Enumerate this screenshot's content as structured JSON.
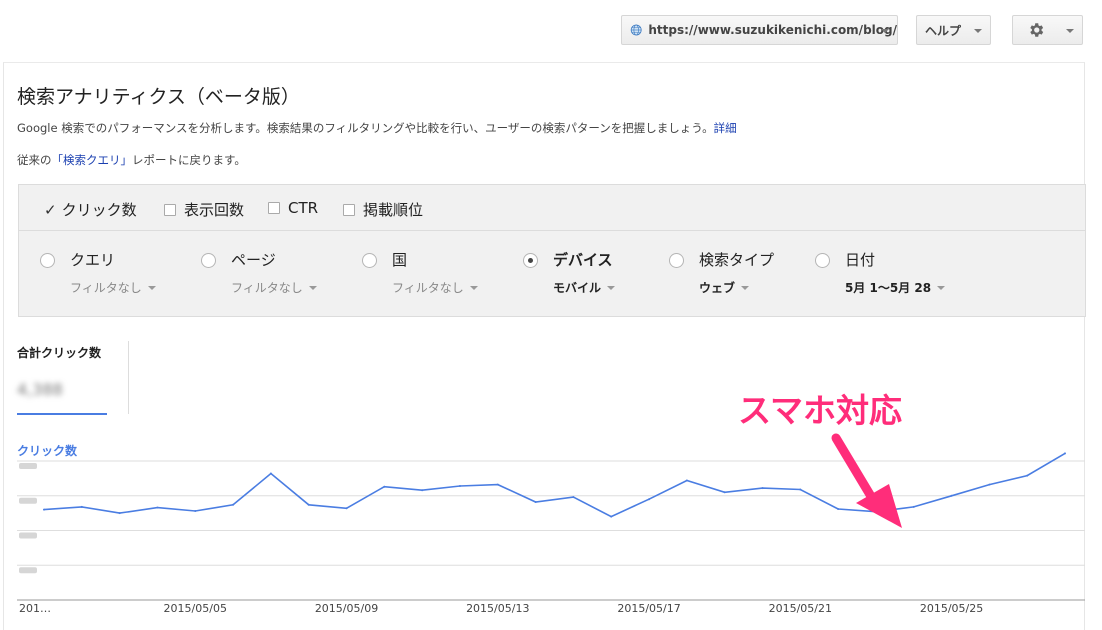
{
  "topbar": {
    "site_url": "https://www.suzukikenichi.com/blog/",
    "help_label": "ヘルプ",
    "site_icon": "globe-icon",
    "settings_icon": "gear-icon"
  },
  "page": {
    "title": "検索アナリティクス（ベータ版）",
    "description": "Google 検索でのパフォーマンスを分析します。検索結果のフィルタリングや比較を行い、ユーザーの検索パターンを把握しましょう。",
    "description_link": "詳細",
    "legacy_prefix": "従来の",
    "legacy_link": "「検索クエリ」",
    "legacy_suffix": "レポートに戻ります。"
  },
  "metrics": [
    {
      "label": "クリック数",
      "checked": true
    },
    {
      "label": "表示回数",
      "checked": false
    },
    {
      "label": "CTR",
      "checked": false
    },
    {
      "label": "掲載順位",
      "checked": false
    }
  ],
  "dimensions": [
    {
      "label": "クエリ",
      "filter": "フィルタなし",
      "selected": false
    },
    {
      "label": "ページ",
      "filter": "フィルタなし",
      "selected": false
    },
    {
      "label": "国",
      "filter": "フィルタなし",
      "selected": false
    },
    {
      "label": "デバイス",
      "filter": "モバイル",
      "selected": true
    },
    {
      "label": "検索タイプ",
      "filter": "ウェブ",
      "selected": false
    },
    {
      "label": "日付",
      "filter": "5月 1〜5月 28",
      "selected": false
    }
  ],
  "summary": {
    "label": "合計クリック数",
    "value": "4,388"
  },
  "annotation": {
    "text": "スマホ対応",
    "color": "#ff2d7a"
  },
  "colors": {
    "accent": "#4a7de2",
    "link": "#1a3fb0"
  },
  "chart_data": {
    "type": "line",
    "series": [
      {
        "name": "クリック数",
        "values": [
          130,
          134,
          125,
          133,
          128,
          137,
          182,
          137,
          132,
          163,
          158,
          164,
          166,
          141,
          148,
          120,
          145,
          172,
          155,
          161,
          159,
          131,
          127,
          134,
          150,
          166,
          179,
          211
        ]
      }
    ],
    "x": [
      "2015/05/01",
      "2015/05/02",
      "2015/05/03",
      "2015/05/04",
      "2015/05/05",
      "2015/05/06",
      "2015/05/07",
      "2015/05/08",
      "2015/05/09",
      "2015/05/10",
      "2015/05/11",
      "2015/05/12",
      "2015/05/13",
      "2015/05/14",
      "2015/05/15",
      "2015/05/16",
      "2015/05/17",
      "2015/05/18",
      "2015/05/19",
      "2015/05/20",
      "2015/05/21",
      "2015/05/22",
      "2015/05/23",
      "2015/05/24",
      "2015/05/25",
      "2015/05/26",
      "2015/05/27",
      "2015/05/28"
    ],
    "tick_labels": [
      "201…",
      "2015/05/05",
      "2015/05/09",
      "2015/05/13",
      "2015/05/17",
      "2015/05/21",
      "2015/05/25"
    ],
    "ylim": [
      0,
      200
    ],
    "grid": true,
    "color": "#4a7de2"
  }
}
